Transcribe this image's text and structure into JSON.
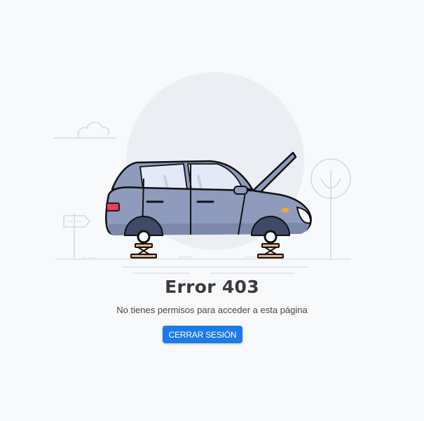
{
  "error": {
    "title": "Error 403",
    "message": "No tienes permisos para acceder a esta página"
  },
  "actions": {
    "logout_label": "CERRAR SESIÓN"
  },
  "colors": {
    "accent": "#1c7be5",
    "car_body": "#8e9bbd",
    "background_circle": "#eceef3"
  }
}
